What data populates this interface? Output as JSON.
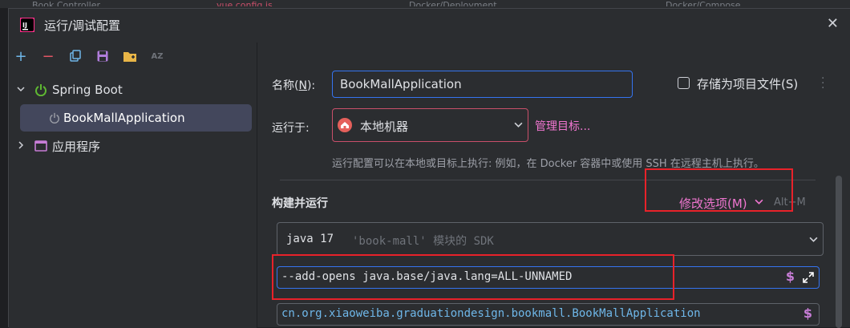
{
  "background_tabs": [
    "Book Controller",
    "vue.config.js",
    "Docker/Deployment",
    "Docker/Compose"
  ],
  "dialog": {
    "title": "运行/调试配置",
    "close_glyph": "✕"
  },
  "toolbar": {
    "add": "+",
    "remove": "−",
    "sort": "AZ"
  },
  "tree": {
    "group1": "Spring Boot",
    "item1": "BookMallApplication",
    "group2": "应用程序"
  },
  "form": {
    "name_label_prefix": "名称(",
    "name_label_mnemonic": "N",
    "name_label_suffix": "):",
    "name_value": "BookMallApplication",
    "store_checkbox_label": "存储为项目文件(S)",
    "store_checked": false,
    "run_on_label": "运行于:",
    "run_on_value": "本地机器",
    "manage_targets": "管理目标...",
    "run_on_hint": "运行配置可以在本地或目标上执行: 例如，在 Docker 容器中或使用 SSH 在远程主机上执行。",
    "build_run_title": "构建并运行",
    "modify_options": "修改选项(M)",
    "modify_shortcut": "Alt+M",
    "sdk_java": "java 17",
    "sdk_detail": "'book-mall' 模块的 SDK",
    "vm_options": "--add-opens java.base/java.lang=ALL-UNNAMED",
    "main_class": "cn.org.xiaoweiba.graduationdesign.bookmall.BookMallApplication",
    "macro_symbol": "$"
  },
  "colors": {
    "accent_link": "#f076d0",
    "highlight_red": "#e8222a",
    "spring_green": "#5fb832",
    "selection": "#43475c"
  },
  "icons": [
    "app-logo-icon",
    "add-icon",
    "remove-icon",
    "copy-icon",
    "save-icon",
    "folder-add-icon",
    "sort-icon",
    "spring-boot-icon",
    "power-icon",
    "app-window-icon",
    "home-icon",
    "chevron-down-icon",
    "expand-icon",
    "dollar-icon",
    "more-vert-icon",
    "close-icon"
  ]
}
